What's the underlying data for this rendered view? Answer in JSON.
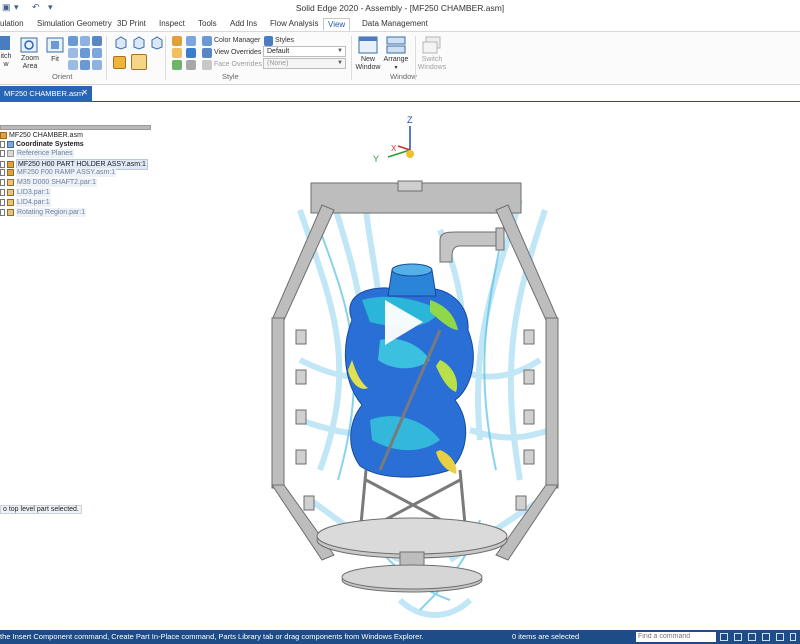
{
  "window": {
    "title": "Solid Edge 2020 - Assembly - [MF250 CHAMBER.asm]"
  },
  "tabs": [
    {
      "label": "ulation"
    },
    {
      "label": "Simulation Geometry"
    },
    {
      "label": "3D Print"
    },
    {
      "label": "Inspect"
    },
    {
      "label": "Tools"
    },
    {
      "label": "Add Ins"
    },
    {
      "label": "Flow Analysis"
    },
    {
      "label": "View"
    },
    {
      "label": "Data Management"
    }
  ],
  "ribbon": {
    "switch_fragment": "itch\nw",
    "zoom_area": "Zoom\nArea",
    "fit": "Fit",
    "orient_group": "Orient",
    "color_manager": "Color Manager",
    "styles": "Styles",
    "view_overrides": "View Overrides",
    "view_overrides_value": "Default",
    "face_overrides": "Face Overrides",
    "face_overrides_value": "(None)",
    "style_group": "Style",
    "new_window": "New\nWindow",
    "arrange": "Arrange",
    "window_group": "Window",
    "switch_windows": "Switch\nWindows"
  },
  "document_tab": {
    "label": "MF250 CHAMBER.asm",
    "close": "✕"
  },
  "pathfinder": {
    "items": [
      {
        "label": "MF250 CHAMBER.asm",
        "style": "plain"
      },
      {
        "label": "Coordinate Systems",
        "style": "plain"
      },
      {
        "label": "Reference Planes",
        "style": "link"
      },
      {
        "label": "MF250 H00 PART HOLDER ASSY.asm:1",
        "style": "hl"
      },
      {
        "label": "MF250 F00 RAMP ASSY.asm:1",
        "style": "link"
      },
      {
        "label": "M35 D000 SHAFT2.par:1",
        "style": "link"
      },
      {
        "label": "LID3.par:1",
        "style": "link"
      },
      {
        "label": "LID4.par:1",
        "style": "link"
      },
      {
        "label": "Rotating Region.par:1",
        "style": "link"
      }
    ],
    "status": "o top level part selected."
  },
  "triad": {
    "z": "Z",
    "y": "Y",
    "x": "X"
  },
  "statusbar": {
    "prompt": "the Insert Component command, Create Part In-Place command, Parts Library tab or drag components from Windows Explorer.",
    "items_selected": "0 items are selected",
    "find_placeholder": "Find a command"
  },
  "colors": {
    "accent": "#2c64b4",
    "statusbar": "#1e4c86"
  }
}
